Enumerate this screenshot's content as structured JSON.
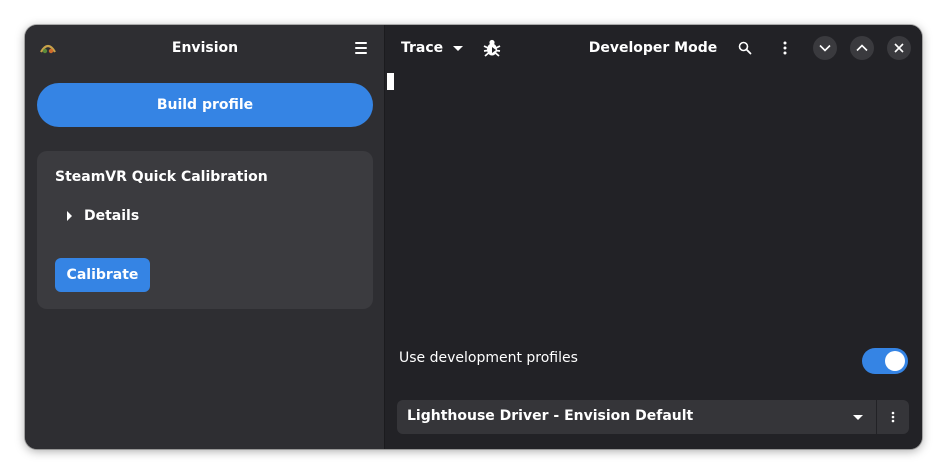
{
  "sidebar": {
    "title": "Envision",
    "build_profile_label": "Build profile",
    "calibration_card": {
      "title": "SteamVR Quick Calibration",
      "details_label": "Details",
      "calibrate_label": "Calibrate"
    }
  },
  "main": {
    "log_level": "Trace",
    "title": "Developer Mode",
    "dev_profiles_label": "Use development profiles",
    "dev_profiles_enabled": true,
    "profile_selected": "Lighthouse Driver - Envision Default"
  },
  "icons": {
    "app": "envision-app-icon",
    "menu": "hamburger-menu-icon",
    "debug": "bug-icon",
    "search": "search-icon",
    "more": "vertical-ellipsis-icon",
    "minimize": "chevron-down-icon",
    "maximize": "chevron-up-icon",
    "close": "close-icon"
  },
  "colors": {
    "accent": "#3584e4",
    "sidebar_bg": "#2e2e32",
    "main_bg": "#222226",
    "card_bg": "#3b3b3f"
  }
}
